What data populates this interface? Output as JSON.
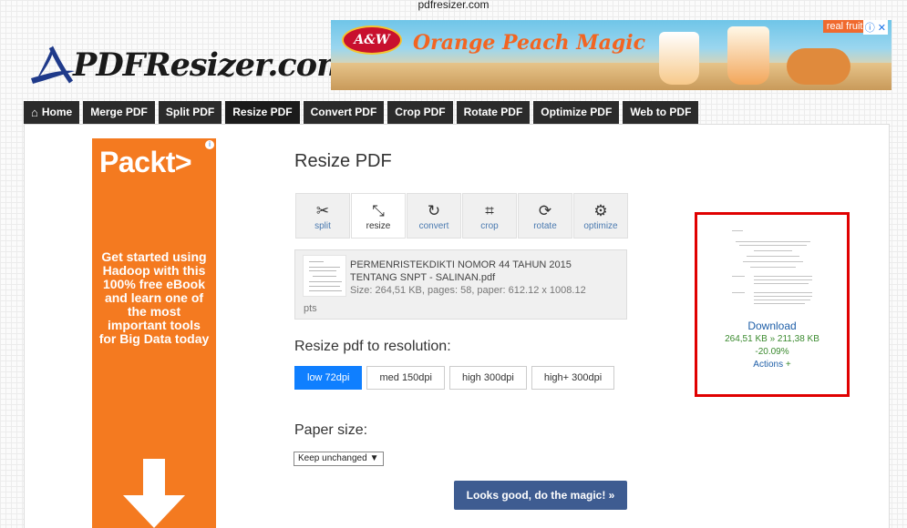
{
  "page": {
    "top_caption": "pdfresizer.com"
  },
  "site": {
    "logo_text": "PDFResizer.com"
  },
  "top_ad": {
    "brand": "A&W",
    "promo": "Orange Peach Magic",
    "tag": "real fruits",
    "close": "ⓘ ✕"
  },
  "nav": {
    "tabs": [
      {
        "label": "Home",
        "icon": "home-icon"
      },
      {
        "label": "Merge PDF"
      },
      {
        "label": "Split PDF"
      },
      {
        "label": "Resize PDF",
        "active": true
      },
      {
        "label": "Convert PDF"
      },
      {
        "label": "Crop PDF"
      },
      {
        "label": "Rotate PDF"
      },
      {
        "label": "Optimize PDF"
      },
      {
        "label": "Web to PDF"
      }
    ]
  },
  "side_ad": {
    "brand": "Packt>",
    "info": "i",
    "copy": "Get started using Hadoop with this 100% free eBook and learn one of the most important tools for Big Data today"
  },
  "main": {
    "title": "Resize PDF",
    "tools": [
      {
        "label": "split",
        "icon": "scissors-icon",
        "glyph": "✂"
      },
      {
        "label": "resize",
        "icon": "resize-icon",
        "glyph": "⤡",
        "active": true
      },
      {
        "label": "convert",
        "icon": "convert-icon",
        "glyph": "↻"
      },
      {
        "label": "crop",
        "icon": "crop-icon",
        "glyph": "⌗"
      },
      {
        "label": "rotate",
        "icon": "rotate-icon",
        "glyph": "⟳"
      },
      {
        "label": "optimize",
        "icon": "optimize-icon",
        "glyph": "⚙"
      }
    ],
    "file": {
      "name": "PERMENRISTEKDIKTI NOMOR 44 TAHUN 2015 TENTANG SNPT - SALINAN.pdf",
      "meta": "Size: 264,51 KB, pages: 58, paper: 612.12 x 1008.12",
      "unit": "pts"
    },
    "resolution_heading": "Resize pdf to resolution:",
    "resolutions": [
      {
        "label": "low 72dpi",
        "active": true
      },
      {
        "label": "med 150dpi"
      },
      {
        "label": "high 300dpi"
      },
      {
        "label": "high+ 300dpi"
      }
    ],
    "paper_heading": "Paper size:",
    "paper_select": "Keep unchanged",
    "paper_arrow": "▼",
    "submit": "Looks good, do the magic! »"
  },
  "result": {
    "download": "Download",
    "sizes": "264,51 KB » 211,38 KB",
    "change": "-20.09%",
    "actions": "Actions",
    "actions_icon": "+"
  },
  "colors": {
    "accent_blue": "#0f7fff",
    "submit_bg": "#3e5c91",
    "highlight_border": "#e00000",
    "ad_orange": "#f47a20"
  }
}
